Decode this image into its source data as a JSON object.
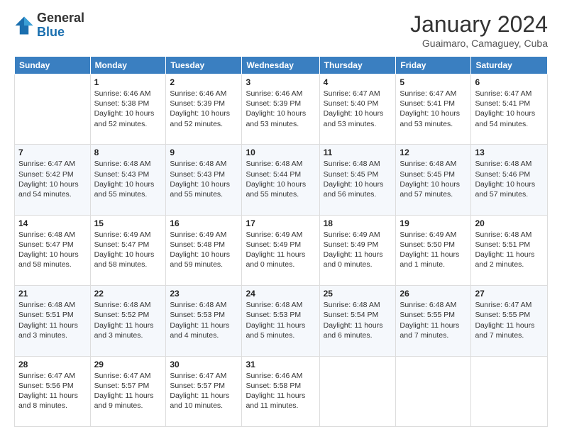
{
  "header": {
    "logo": {
      "general": "General",
      "blue": "Blue"
    },
    "title": "January 2024",
    "location": "Guaimaro, Camaguey, Cuba"
  },
  "columns": [
    "Sunday",
    "Monday",
    "Tuesday",
    "Wednesday",
    "Thursday",
    "Friday",
    "Saturday"
  ],
  "weeks": [
    [
      {
        "day": "",
        "info": ""
      },
      {
        "day": "1",
        "info": "Sunrise: 6:46 AM\nSunset: 5:38 PM\nDaylight: 10 hours\nand 52 minutes."
      },
      {
        "day": "2",
        "info": "Sunrise: 6:46 AM\nSunset: 5:39 PM\nDaylight: 10 hours\nand 52 minutes."
      },
      {
        "day": "3",
        "info": "Sunrise: 6:46 AM\nSunset: 5:39 PM\nDaylight: 10 hours\nand 53 minutes."
      },
      {
        "day": "4",
        "info": "Sunrise: 6:47 AM\nSunset: 5:40 PM\nDaylight: 10 hours\nand 53 minutes."
      },
      {
        "day": "5",
        "info": "Sunrise: 6:47 AM\nSunset: 5:41 PM\nDaylight: 10 hours\nand 53 minutes."
      },
      {
        "day": "6",
        "info": "Sunrise: 6:47 AM\nSunset: 5:41 PM\nDaylight: 10 hours\nand 54 minutes."
      }
    ],
    [
      {
        "day": "7",
        "info": "Sunrise: 6:47 AM\nSunset: 5:42 PM\nDaylight: 10 hours\nand 54 minutes."
      },
      {
        "day": "8",
        "info": "Sunrise: 6:48 AM\nSunset: 5:43 PM\nDaylight: 10 hours\nand 55 minutes."
      },
      {
        "day": "9",
        "info": "Sunrise: 6:48 AM\nSunset: 5:43 PM\nDaylight: 10 hours\nand 55 minutes."
      },
      {
        "day": "10",
        "info": "Sunrise: 6:48 AM\nSunset: 5:44 PM\nDaylight: 10 hours\nand 55 minutes."
      },
      {
        "day": "11",
        "info": "Sunrise: 6:48 AM\nSunset: 5:45 PM\nDaylight: 10 hours\nand 56 minutes."
      },
      {
        "day": "12",
        "info": "Sunrise: 6:48 AM\nSunset: 5:45 PM\nDaylight: 10 hours\nand 57 minutes."
      },
      {
        "day": "13",
        "info": "Sunrise: 6:48 AM\nSunset: 5:46 PM\nDaylight: 10 hours\nand 57 minutes."
      }
    ],
    [
      {
        "day": "14",
        "info": "Sunrise: 6:48 AM\nSunset: 5:47 PM\nDaylight: 10 hours\nand 58 minutes."
      },
      {
        "day": "15",
        "info": "Sunrise: 6:49 AM\nSunset: 5:47 PM\nDaylight: 10 hours\nand 58 minutes."
      },
      {
        "day": "16",
        "info": "Sunrise: 6:49 AM\nSunset: 5:48 PM\nDaylight: 10 hours\nand 59 minutes."
      },
      {
        "day": "17",
        "info": "Sunrise: 6:49 AM\nSunset: 5:49 PM\nDaylight: 11 hours\nand 0 minutes."
      },
      {
        "day": "18",
        "info": "Sunrise: 6:49 AM\nSunset: 5:49 PM\nDaylight: 11 hours\nand 0 minutes."
      },
      {
        "day": "19",
        "info": "Sunrise: 6:49 AM\nSunset: 5:50 PM\nDaylight: 11 hours\nand 1 minute."
      },
      {
        "day": "20",
        "info": "Sunrise: 6:48 AM\nSunset: 5:51 PM\nDaylight: 11 hours\nand 2 minutes."
      }
    ],
    [
      {
        "day": "21",
        "info": "Sunrise: 6:48 AM\nSunset: 5:51 PM\nDaylight: 11 hours\nand 3 minutes."
      },
      {
        "day": "22",
        "info": "Sunrise: 6:48 AM\nSunset: 5:52 PM\nDaylight: 11 hours\nand 3 minutes."
      },
      {
        "day": "23",
        "info": "Sunrise: 6:48 AM\nSunset: 5:53 PM\nDaylight: 11 hours\nand 4 minutes."
      },
      {
        "day": "24",
        "info": "Sunrise: 6:48 AM\nSunset: 5:53 PM\nDaylight: 11 hours\nand 5 minutes."
      },
      {
        "day": "25",
        "info": "Sunrise: 6:48 AM\nSunset: 5:54 PM\nDaylight: 11 hours\nand 6 minutes."
      },
      {
        "day": "26",
        "info": "Sunrise: 6:48 AM\nSunset: 5:55 PM\nDaylight: 11 hours\nand 7 minutes."
      },
      {
        "day": "27",
        "info": "Sunrise: 6:47 AM\nSunset: 5:55 PM\nDaylight: 11 hours\nand 7 minutes."
      }
    ],
    [
      {
        "day": "28",
        "info": "Sunrise: 6:47 AM\nSunset: 5:56 PM\nDaylight: 11 hours\nand 8 minutes."
      },
      {
        "day": "29",
        "info": "Sunrise: 6:47 AM\nSunset: 5:57 PM\nDaylight: 11 hours\nand 9 minutes."
      },
      {
        "day": "30",
        "info": "Sunrise: 6:47 AM\nSunset: 5:57 PM\nDaylight: 11 hours\nand 10 minutes."
      },
      {
        "day": "31",
        "info": "Sunrise: 6:46 AM\nSunset: 5:58 PM\nDaylight: 11 hours\nand 11 minutes."
      },
      {
        "day": "",
        "info": ""
      },
      {
        "day": "",
        "info": ""
      },
      {
        "day": "",
        "info": ""
      }
    ]
  ]
}
